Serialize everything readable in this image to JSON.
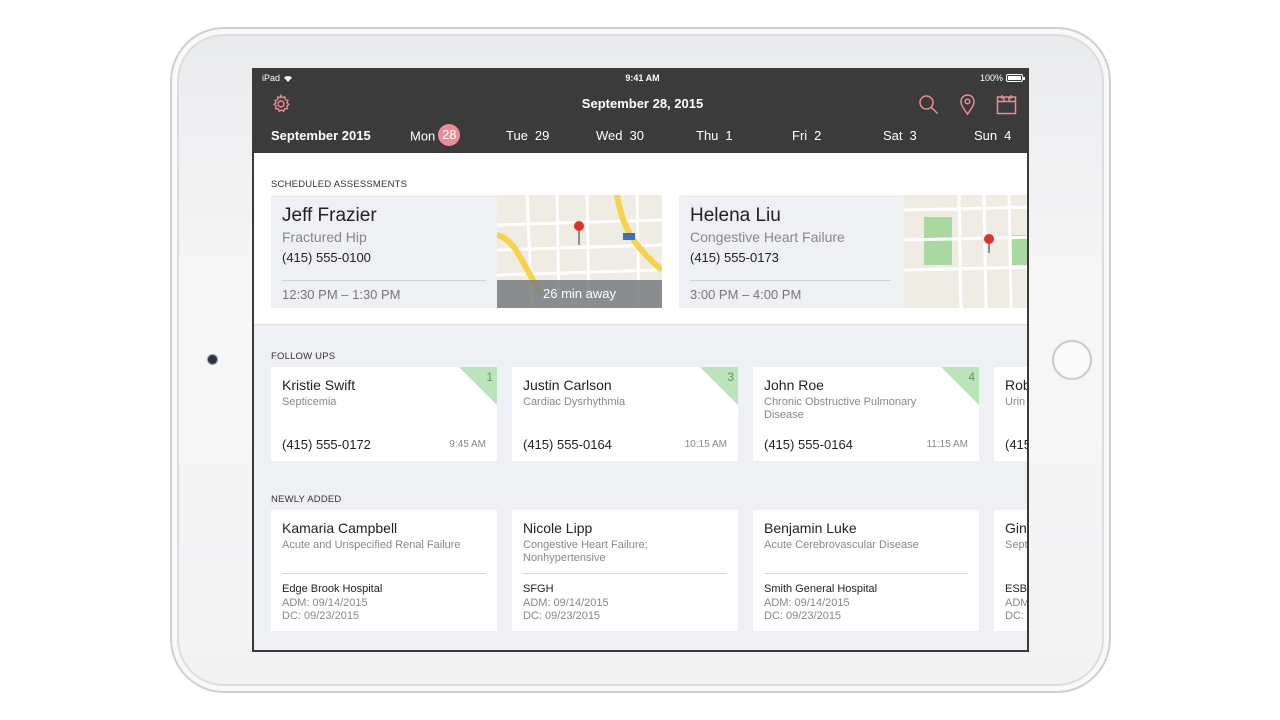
{
  "status_bar": {
    "carrier": "iPad",
    "time": "9:41 AM",
    "battery": "100%"
  },
  "header": {
    "title": "September 28, 2015",
    "icons": [
      "gear-icon",
      "search-icon",
      "location-pin-icon",
      "calendar-icon"
    ],
    "accent_color": "#e98d97"
  },
  "week": {
    "month": "September 2015",
    "days": [
      {
        "label": "Mon",
        "num": "28",
        "selected": true
      },
      {
        "label": "Tue",
        "num": "29"
      },
      {
        "label": "Wed",
        "num": "30"
      },
      {
        "label": "Thu",
        "num": "1"
      },
      {
        "label": "Fri",
        "num": "2"
      },
      {
        "label": "Sat",
        "num": "3"
      },
      {
        "label": "Sun",
        "num": "4"
      }
    ]
  },
  "assessments": {
    "label": "SCHEDULED ASSESSMENTS",
    "items": [
      {
        "name": "Jeff Frazier",
        "condition": "Fractured Hip",
        "phone": "(415) 555-0100",
        "time": "12:30 PM – 1:30 PM",
        "away": "26 min away"
      },
      {
        "name": "Helena Liu",
        "condition": "Congestive Heart Failure",
        "phone": "(415) 555-0173",
        "time": "3:00 PM – 4:00 PM"
      }
    ]
  },
  "follow_ups": {
    "label": "FOLLOW UPS",
    "items": [
      {
        "name": "Kristie Swift",
        "condition": "Septicemia",
        "phone": "(415) 555-0172",
        "time": "9:45 AM",
        "badge": "1"
      },
      {
        "name": "Justin Carlson",
        "condition": "Cardiac Dysrhythmia",
        "phone": "(415) 555-0164",
        "time": "10:15 AM",
        "badge": "3"
      },
      {
        "name": "John Roe",
        "condition": "Chronic Obstructive Pulmonary Disease",
        "phone": "(415) 555-0164",
        "time": "11:15 AM",
        "badge": "4"
      },
      {
        "name": "Rob",
        "condition": "Urin",
        "phone": "(415"
      }
    ]
  },
  "newly_added": {
    "label": "NEWLY ADDED",
    "items": [
      {
        "name": "Kamaria Campbell",
        "condition": "Acute and Unspecified Renal Failure",
        "hospital": "Edge Brook Hospital",
        "adm": "ADM: 09/14/2015",
        "dc": "DC: 09/23/2015"
      },
      {
        "name": "Nicole Lipp",
        "condition": "Congestive Heart Failure; Nonhypertensive",
        "hospital": "SFGH",
        "adm": "ADM: 09/14/2015",
        "dc": "DC: 09/23/2015"
      },
      {
        "name": "Benjamin Luke",
        "condition": "Acute Cerebrovascular Disease",
        "hospital": "Smith General Hospital",
        "adm": "ADM: 09/14/2015",
        "dc": "DC: 09/23/2015"
      },
      {
        "name": "Gin",
        "condition": "Sept",
        "hospital": "ESB",
        "adm": "ADM",
        "dc": "DC:"
      }
    ]
  }
}
